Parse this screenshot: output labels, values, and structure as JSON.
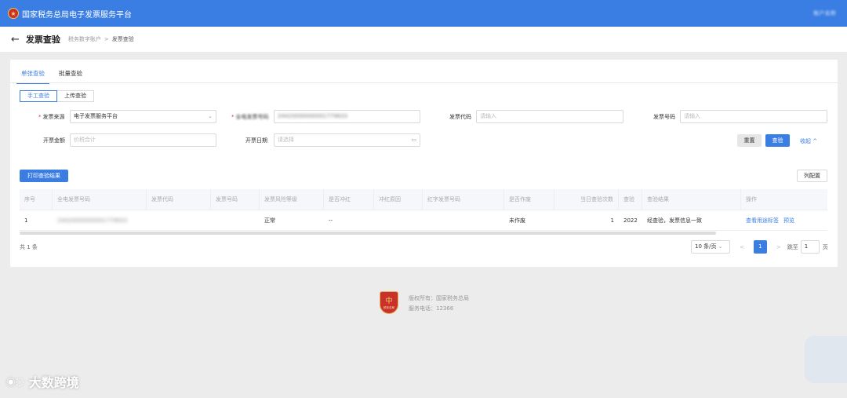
{
  "header": {
    "title": "国家税务总局电子发票服务平台",
    "user": "账户名称"
  },
  "breadcrumb": {
    "page_title": "发票查验",
    "parent": "税务数字账户",
    "separator": ">",
    "current": "发票查验"
  },
  "tabs": [
    {
      "label": "单张查验",
      "active": true
    },
    {
      "label": "批量查验",
      "active": false
    }
  ],
  "mode_toggle": [
    {
      "label": "手工查验",
      "active": true
    },
    {
      "label": "上传查验",
      "active": false
    }
  ],
  "form": {
    "source_label": "发票来源",
    "source_value": "电子发票服务平台",
    "number_full_label": "全电发票号码",
    "number_full_value": "24420000000001779633",
    "code_label": "发票代码",
    "code_placeholder": "请输入",
    "number_label": "发票号码",
    "number_placeholder": "请输入",
    "amount_label": "开票金额",
    "amount_placeholder": "价税合计",
    "date_label": "开票日期",
    "date_placeholder": "请选择",
    "reset": "重置",
    "verify": "查验",
    "collapse": "收起"
  },
  "toolbar": {
    "print_button": "打印查验结果",
    "columns_button": "列配置"
  },
  "table": {
    "columns": [
      "序号",
      "全电发票号码",
      "发票代码",
      "发票号码",
      "发票风险等级",
      "是否冲红",
      "冲红原因",
      "红字发票号码",
      "是否作废",
      "当日查验次数",
      "查验",
      "查验结果",
      "操作"
    ],
    "rows": [
      {
        "index": "1",
        "full_number": "24420000000001779633",
        "code": "",
        "number": "",
        "risk": "正常",
        "red": "--",
        "red_reason": "",
        "red_number": "",
        "void": "未作废",
        "count": "1",
        "time": "2022",
        "result": "经查验，发票信息一致",
        "op_view": "查看用途标签",
        "op_preview": "预览"
      }
    ]
  },
  "pagination": {
    "total": "共 1 条",
    "page_size": "10 条/页",
    "prev": "<",
    "current": "1",
    "next": ">",
    "jump_label": "跳至",
    "jump_value": "1",
    "page_unit": "页"
  },
  "footer": {
    "emblem_text": "中",
    "emblem_caption": "税务总局",
    "copyright": "版权所有：国家税务总局",
    "phone": "服务电话：12366"
  },
  "watermark": {
    "text": "大数跨境"
  },
  "colors": {
    "brand": "#3a7ee4",
    "emblem": "#c8322b"
  }
}
